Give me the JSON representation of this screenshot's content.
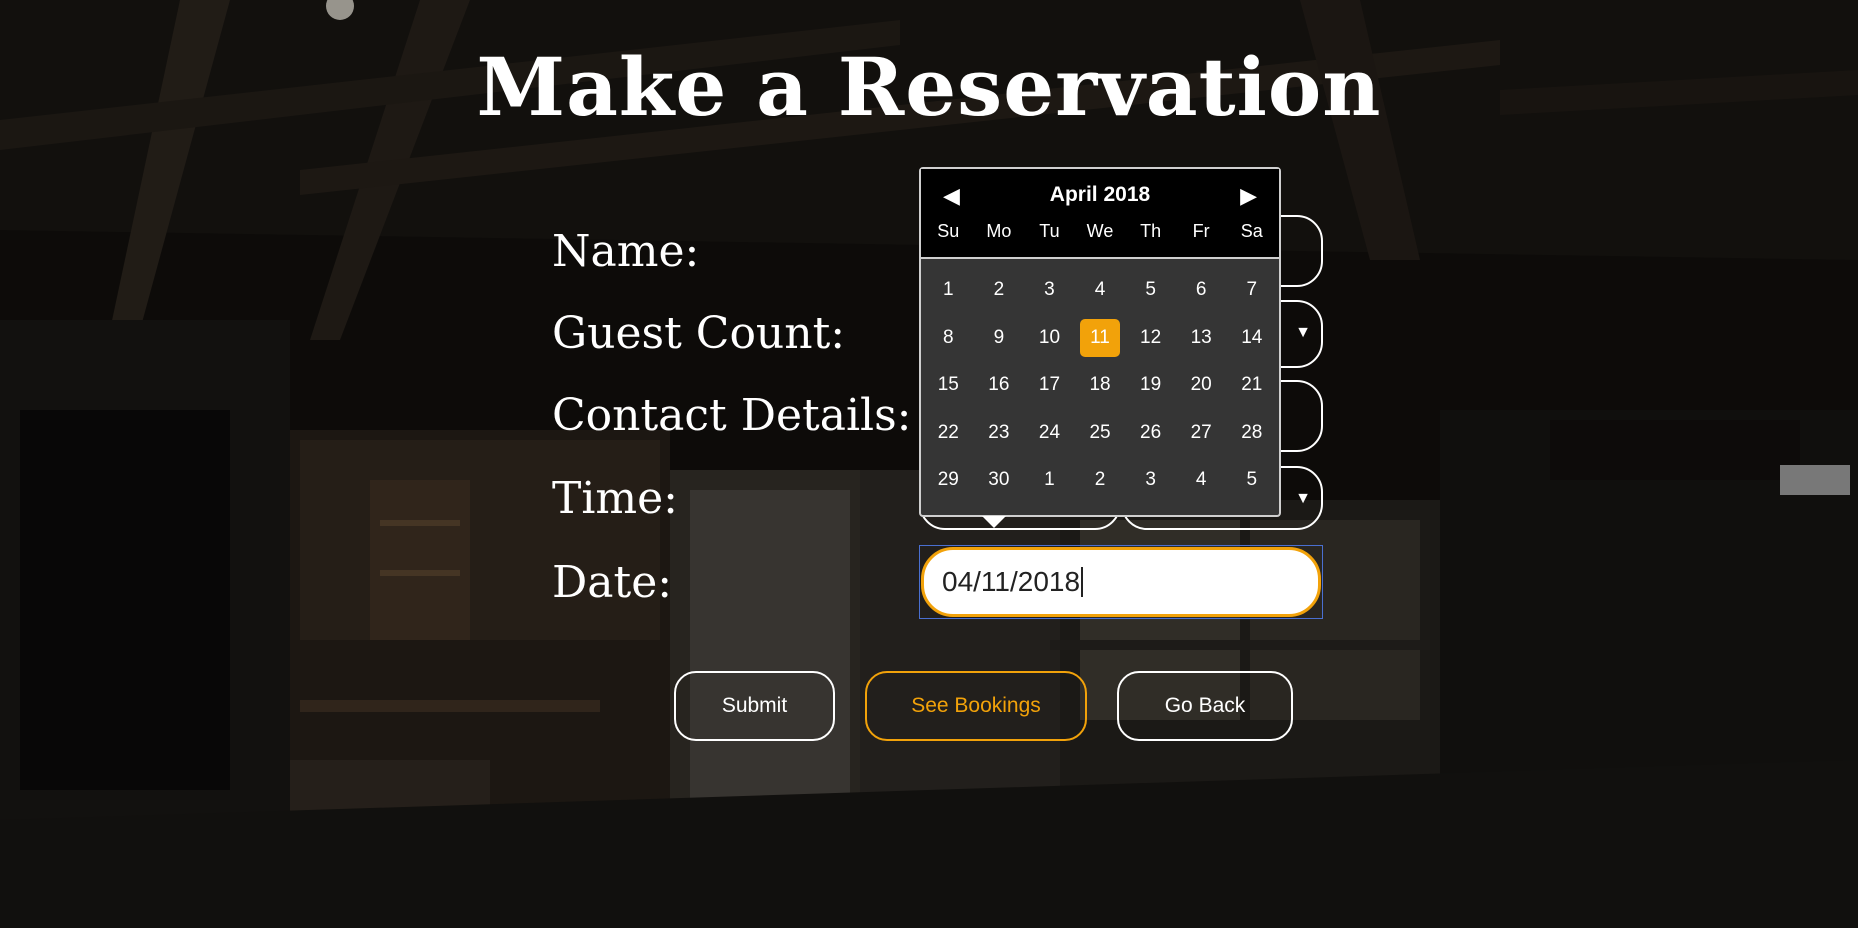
{
  "page": {
    "title": "Make a Reservation"
  },
  "form": {
    "name_label": "Name:",
    "guest_label": "Guest Count:",
    "contact_label": "Contact Details:",
    "time_label": "Time:",
    "date_label": "Date:",
    "date_value": "04/11/2018"
  },
  "datepicker": {
    "month_label": "April 2018",
    "weekdays": [
      "Su",
      "Mo",
      "Tu",
      "We",
      "Th",
      "Fr",
      "Sa"
    ],
    "weeks": [
      [
        "1",
        "2",
        "3",
        "4",
        "5",
        "6",
        "7"
      ],
      [
        "8",
        "9",
        "10",
        "11",
        "12",
        "13",
        "14"
      ],
      [
        "15",
        "16",
        "17",
        "18",
        "19",
        "20",
        "21"
      ],
      [
        "22",
        "23",
        "24",
        "25",
        "26",
        "27",
        "28"
      ],
      [
        "29",
        "30",
        "1",
        "2",
        "3",
        "4",
        "5"
      ]
    ],
    "selected_day": "11"
  },
  "buttons": {
    "submit": "Submit",
    "see_bookings": "See Bookings",
    "go_back": "Go Back"
  },
  "icons": {
    "prev": "chevron-left-icon",
    "next": "chevron-right-icon",
    "dropdown": "caret-down-icon"
  },
  "colors": {
    "accent": "#f2a20a",
    "picker_bg": "#353535",
    "header_bg": "#000000",
    "focus_outline": "#4a6fd0"
  }
}
